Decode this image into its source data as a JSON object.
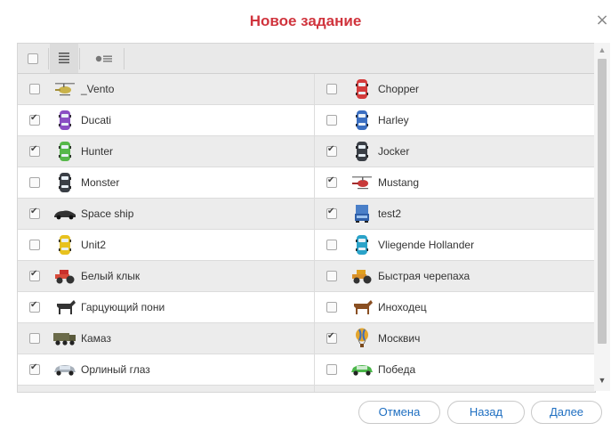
{
  "dialog": {
    "title": "Новое задание",
    "close_symbol": "×"
  },
  "units": [
    {
      "left": {
        "name": "_Vento",
        "checked": false,
        "icon": "helicopter-icon"
      },
      "right": {
        "name": "Chopper",
        "checked": false,
        "icon": "car-red-icon"
      }
    },
    {
      "left": {
        "name": "Ducati",
        "checked": true,
        "icon": "car-purple-icon"
      },
      "right": {
        "name": "Harley",
        "checked": false,
        "icon": "car-blue-icon"
      }
    },
    {
      "left": {
        "name": "Hunter",
        "checked": true,
        "icon": "car-green-icon"
      },
      "right": {
        "name": "Jocker",
        "checked": true,
        "icon": "car-dark-icon"
      }
    },
    {
      "left": {
        "name": "Monster",
        "checked": false,
        "icon": "car-dark-icon"
      },
      "right": {
        "name": "Mustang",
        "checked": true,
        "icon": "helicopter-red-icon"
      }
    },
    {
      "left": {
        "name": "Space ship",
        "checked": true,
        "icon": "sports-car-icon"
      },
      "right": {
        "name": "test2",
        "checked": true,
        "icon": "truck-blue-icon"
      }
    },
    {
      "left": {
        "name": "Unit2",
        "checked": false,
        "icon": "car-yellow-icon"
      },
      "right": {
        "name": "Vliegende Hollander",
        "checked": false,
        "icon": "car-teal-icon"
      }
    },
    {
      "left": {
        "name": "Белый клык",
        "checked": true,
        "icon": "tractor-red-icon"
      },
      "right": {
        "name": "Быстрая черепаха",
        "checked": false,
        "icon": "tractor-yellow-icon"
      }
    },
    {
      "left": {
        "name": "Гарцующий пони",
        "checked": true,
        "icon": "horse-dark-icon"
      },
      "right": {
        "name": "Иноходец",
        "checked": false,
        "icon": "horse-brown-icon"
      }
    },
    {
      "left": {
        "name": "Камаз",
        "checked": false,
        "icon": "army-truck-icon"
      },
      "right": {
        "name": "Москвич",
        "checked": true,
        "icon": "balloon-icon"
      }
    },
    {
      "left": {
        "name": "Орлиный глаз",
        "checked": true,
        "icon": "sedan-silver-icon"
      },
      "right": {
        "name": "Победа",
        "checked": false,
        "icon": "sedan-green-icon"
      }
    }
  ],
  "buttons": {
    "cancel": "Отмена",
    "back": "Назад",
    "next": "Далее"
  },
  "colors": {
    "title": "#d0343d",
    "button_text": "#1f6fc1",
    "row_alt": "#ececec"
  }
}
